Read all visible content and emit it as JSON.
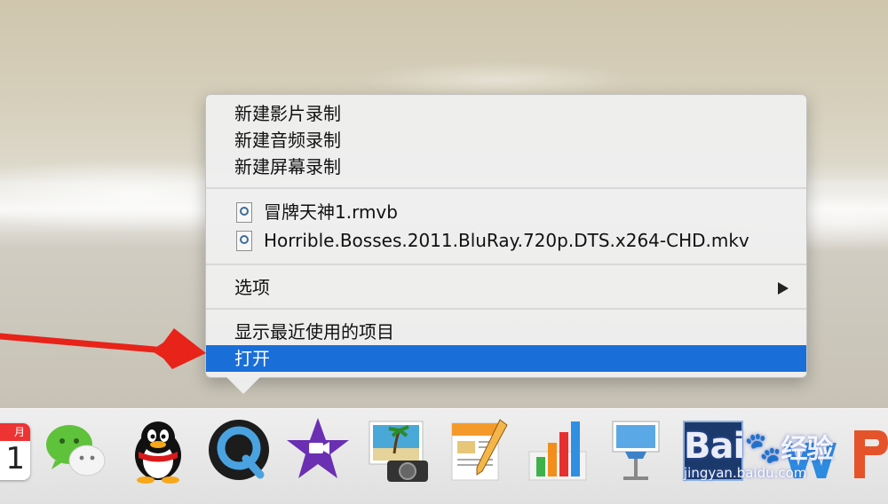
{
  "context_menu": {
    "new_items": [
      "新建影片录制",
      "新建音频录制",
      "新建屏幕录制"
    ],
    "recent_files": [
      "冒牌天神1.rmvb",
      "Horrible.Bosses.2011.BluRay.720p.DTS.x264-CHD.mkv"
    ],
    "options_label": "选项",
    "show_recent_label": "显示最近使用的项目",
    "open_label": "打开"
  },
  "dock": {
    "calendar_month": "月",
    "calendar_day": "1",
    "apps": [
      "calendar",
      "wechat",
      "qq",
      "quicktime-player",
      "imovie",
      "iphoto",
      "pages",
      "numbers",
      "keynote",
      "photoshop",
      "word",
      "powerpoint"
    ]
  },
  "watermark": {
    "logo_text": "Bai",
    "logo_cn": "经验",
    "url": "jingyan.baidu.com"
  },
  "colors": {
    "selection": "#1a6ed8",
    "annotation_arrow": "#e8231a"
  }
}
